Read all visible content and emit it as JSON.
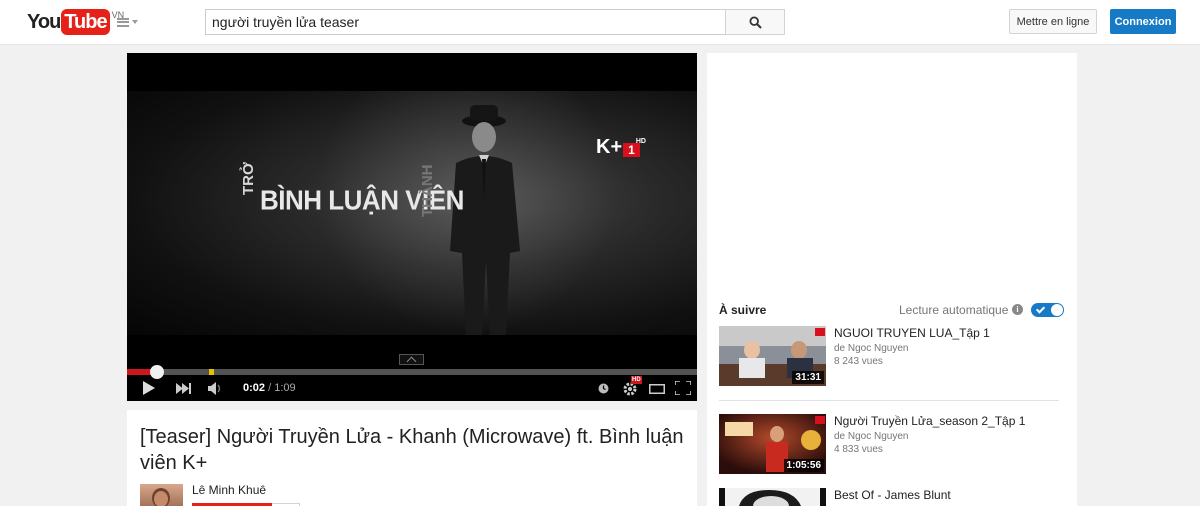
{
  "header": {
    "logo_you": "You",
    "logo_tube": "Tube",
    "logo_country": "VN",
    "search_value": "người truyền lửa teaser",
    "upload_label": "Mettre en ligne",
    "signin_label": "Connexion"
  },
  "player": {
    "overlay_main": "BÌNH LUẬN VIÊN",
    "overlay_left": "TRỞ",
    "overlay_right": "THÀNH",
    "channel_logo": "K+",
    "channel_logo_num": "1",
    "channel_logo_hd": "HD",
    "current_time": "0:02",
    "time_separator": "/",
    "duration": "1:09",
    "progress_fraction": 0.052,
    "quality_badge": "HD",
    "accent_color": "#cc181e"
  },
  "video_info": {
    "title": "[Teaser] Người Truyền Lửa - Khanh (Microwave) ft. Bình luận viên K+",
    "channel_name": "Lê Minh Khuê"
  },
  "sidebar": {
    "up_next_label": "À suivre",
    "autoplay_label": "Lecture automatique",
    "autoplay_on": true,
    "items": [
      {
        "title": "NGUOI TRUYEN LUA_Tập 1",
        "author": "de Ngoc Nguyen",
        "views": "8 243 vues",
        "duration": "31:31"
      },
      {
        "title": "Người Truyền Lửa_season 2_Tập 1",
        "author": "de Ngoc Nguyen",
        "views": "4 833 vues",
        "duration": "1:05:56"
      },
      {
        "title": "Best Of - James Blunt",
        "author": "",
        "views": "",
        "duration": ""
      }
    ]
  },
  "icons": [
    "youtube-logo",
    "guide-menu-icon",
    "search-icon",
    "play-icon",
    "next-icon",
    "volume-icon",
    "watch-later-icon",
    "settings-icon",
    "theater-mode-icon",
    "fullscreen-icon",
    "info-icon"
  ]
}
